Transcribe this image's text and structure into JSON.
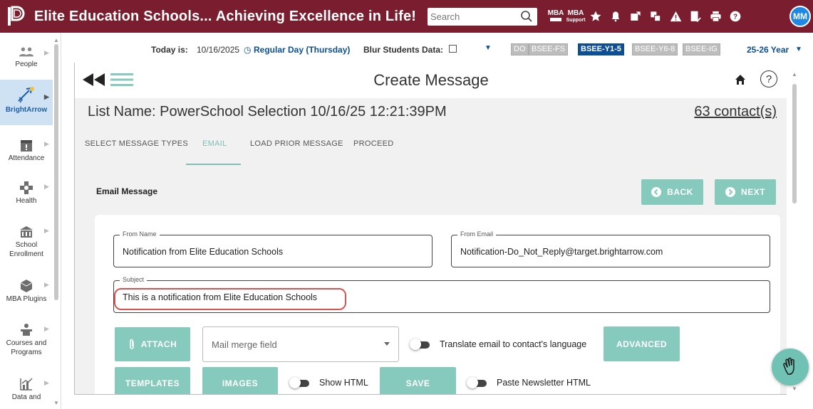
{
  "topbar": {
    "title": "Elite Education Schools... Achieving Excellence in Life!",
    "search_placeholder": "Search",
    "mba_label": "MBA",
    "mba_support_top": "MBA",
    "mba_support_bottom": "Support",
    "avatar": "MM"
  },
  "sidebar": {
    "items": [
      {
        "label": "People",
        "icon": "people-icon"
      },
      {
        "label": "BrightArrow",
        "icon": "brightarrow-icon",
        "active": true
      },
      {
        "label": "Attendance",
        "icon": "attendance-icon"
      },
      {
        "label": "Health",
        "icon": "health-icon"
      },
      {
        "label": "School Enrollment",
        "icon": "school-icon"
      },
      {
        "label": "MBA Plugins",
        "icon": "plugin-icon"
      },
      {
        "label": "Courses and Programs",
        "icon": "courses-icon"
      },
      {
        "label": "Data and",
        "icon": "chart-icon"
      }
    ]
  },
  "infobar": {
    "today_label": "Today is:",
    "today_value": "10/16/2025",
    "day_type": "Regular Day (Thursday)",
    "blur_label": "Blur Students Data:",
    "chips": [
      {
        "label": "DO",
        "active": false
      },
      {
        "label": "BSEE-FS",
        "active": false
      },
      {
        "label": "BSEE-Y1-5",
        "active": true
      },
      {
        "label": "BSEE-Y6-8",
        "active": false
      },
      {
        "label": "BSEE-IG",
        "active": false
      }
    ],
    "year": "25-26 Year"
  },
  "main": {
    "title": "Create Message",
    "list_name": "List Name: PowerSchool Selection 10/16/25 12:21:39PM",
    "contacts": "63 contact(s)",
    "tabs": [
      "SELECT MESSAGE TYPES",
      "EMAIL",
      "LOAD PRIOR MESSAGE",
      "PROCEED"
    ],
    "active_tab": "EMAIL",
    "section_label": "Email Message",
    "back_label": "BACK",
    "next_label": "NEXT"
  },
  "form": {
    "from_name_label": "From Name",
    "from_name_value": "Notification from Elite Education Schools",
    "from_email_label": "From Email",
    "from_email_value": "Notification-Do_Not_Reply@target.brightarrow.com",
    "subject_label": "Subject",
    "subject_value": "This is a notification from Elite Education Schools",
    "attach_label": "ATTACH",
    "merge_placeholder": "Mail merge field",
    "translate_label": "Translate email to contact's language",
    "advanced_label": "ADVANCED",
    "templates_label": "TEMPLATES",
    "images_label": "IMAGES",
    "show_html_label": "Show HTML",
    "save_label": "SAVE",
    "paste_newsletter_label": "Paste Newsletter HTML"
  },
  "colors": {
    "topbar": "#7a1d2e",
    "accent": "#86c9bd",
    "active_chip": "#0d4f92",
    "highlight": "#d9534f"
  }
}
